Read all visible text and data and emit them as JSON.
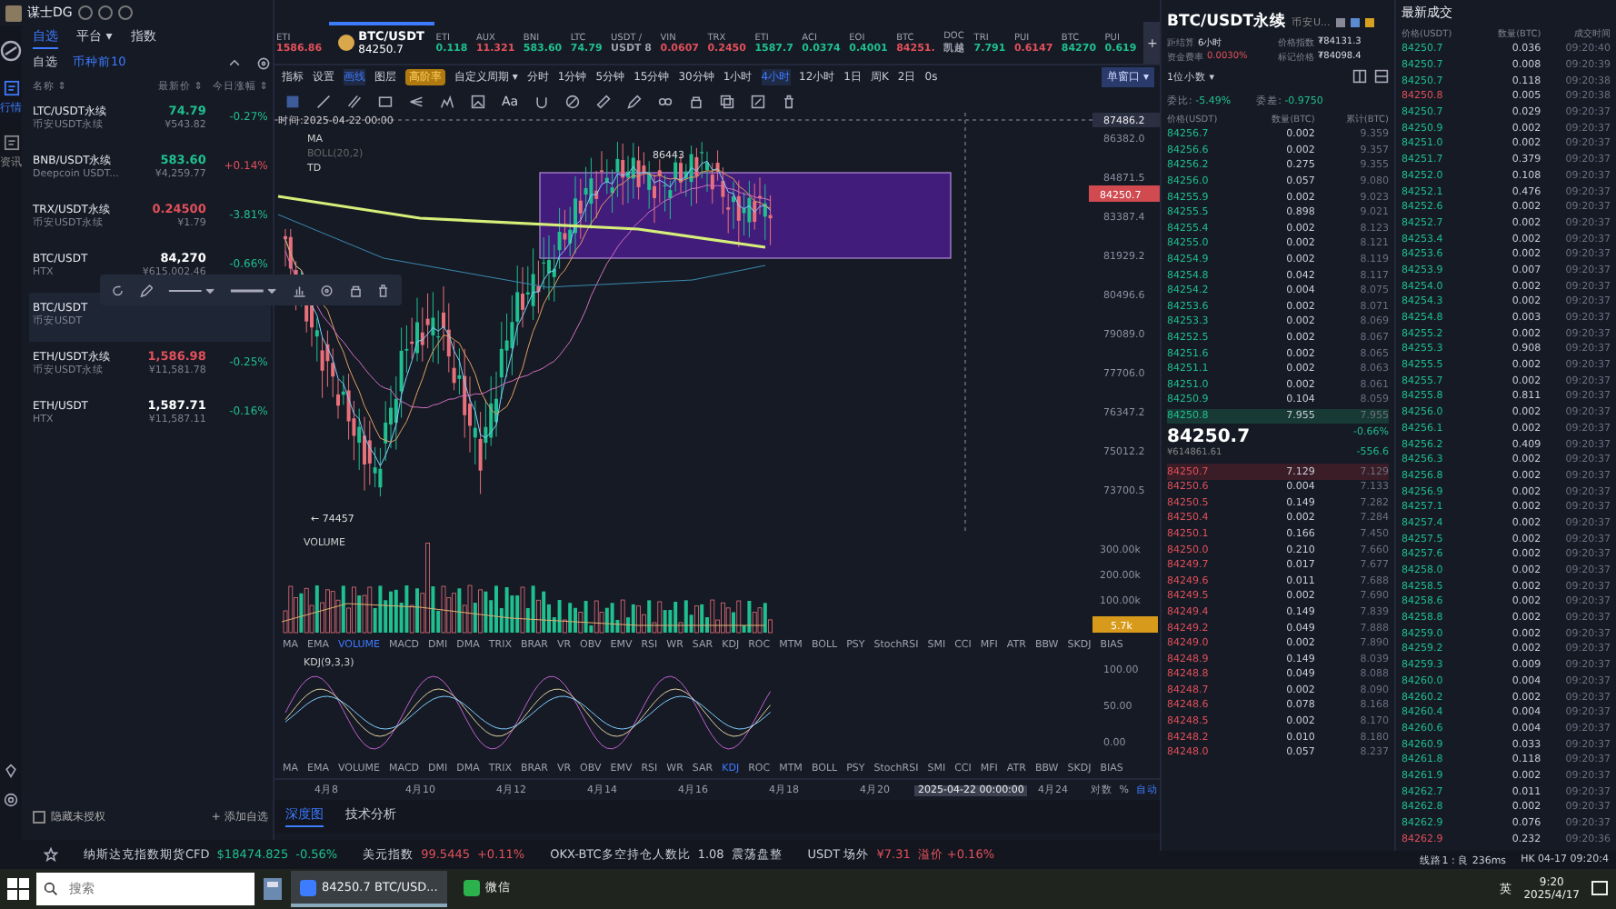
{
  "app_title": "谋士DG",
  "rail": [
    {
      "label": "行情",
      "selected": true
    },
    {
      "label": "资讯",
      "selected": false
    }
  ],
  "watch_tabs": [
    {
      "label": "自选",
      "selected": true
    },
    {
      "label": "平台 ▾",
      "selected": false
    },
    {
      "label": "指数",
      "selected": false
    }
  ],
  "sub_tabs": [
    {
      "label": "自选",
      "selected": false
    },
    {
      "label": "币种前10",
      "selected": true
    }
  ],
  "list_columns": [
    "名称 ⇕",
    "最新价 ⇕",
    "今日涨幅 ⇕"
  ],
  "watchlist": [
    {
      "name": "LTC/USDT永续",
      "exchange": "币安USDT永续",
      "price": {
        "text": "74.79",
        "color": "#1fbf8f"
      },
      "cny": "¥543.82",
      "change": {
        "text": "-0.27%",
        "color": "#1fbf8f"
      },
      "selected": false
    },
    {
      "name": "BNB/USDT永续",
      "exchange": "Deepcoin USDT...",
      "price": {
        "text": "583.60",
        "color": "#1fbf8f"
      },
      "cny": "¥4,259.77",
      "change": {
        "text": "+0.14%",
        "color": "#e0505a"
      },
      "selected": false
    },
    {
      "name": "TRX/USDT永续",
      "exchange": "币安USDT永续",
      "price": {
        "text": "0.24500",
        "color": "#e0505a"
      },
      "cny": "¥1.79",
      "change": {
        "text": "-3.81%",
        "color": "#1fbf8f"
      },
      "selected": false
    },
    {
      "name": "BTC/USDT",
      "exchange": "HTX",
      "price": {
        "text": "84,270",
        "color": "#ffffff"
      },
      "cny": "¥615,002.46",
      "change": {
        "text": "-0.66%",
        "color": "#1fbf8f"
      },
      "selected": false
    },
    {
      "name": "BTC/USDT",
      "exchange": "币安USDT",
      "selected": true
    },
    {
      "name": "ETH/USDT永续",
      "exchange": "币安USDT永续",
      "price": {
        "text": "1,586.98",
        "color": "#e0505a"
      },
      "cny": "¥11,581.78",
      "change": {
        "text": "-0.25%",
        "color": "#1fbf8f"
      },
      "selected": false
    },
    {
      "name": "ETH/USDT",
      "exchange": "HTX",
      "price": {
        "text": "1,587.71",
        "color": "#ffffff"
      },
      "cny": "¥11,587.11",
      "change": {
        "text": "-0.16%",
        "color": "#1fbf8f"
      },
      "selected": false
    }
  ],
  "hide_unauthorized": {
    "label": "隐藏未授权",
    "checked": false
  },
  "add_watch": "+ 添加自选",
  "ticker_strip": [
    {
      "symbol": "ETI",
      "price": "1586.86",
      "color": "#e0505a",
      "selected": false
    },
    {
      "symbol": "BTC/USDT",
      "price": "84250.7",
      "color": "#ffffff",
      "selected": true
    },
    {
      "symbol": "ETI",
      "price": "0.118",
      "color": "#1fbf8f",
      "selected": false
    },
    {
      "symbol": "AUX",
      "price": "11.321",
      "color": "#e0505a",
      "selected": false
    },
    {
      "symbol": "BNI",
      "price": "583.60",
      "color": "#1fbf8f",
      "selected": false
    },
    {
      "symbol": "LTC",
      "price": "74.79",
      "color": "#1fbf8f",
      "selected": false
    },
    {
      "symbol": "USDT /",
      "price": "USDT 8",
      "color": "#9aa0ad",
      "selected": false
    },
    {
      "symbol": "VIN",
      "price": "0.0607",
      "color": "#e0505a",
      "selected": false
    },
    {
      "symbol": "TRX",
      "price": "0.2450",
      "color": "#e0505a",
      "selected": false
    },
    {
      "symbol": "ETI",
      "price": "1587.7",
      "color": "#1fbf8f",
      "selected": false
    },
    {
      "symbol": "ACI",
      "price": "0.0374",
      "color": "#1fbf8f",
      "selected": false
    },
    {
      "symbol": "EOI",
      "price": "0.4001",
      "color": "#1fbf8f",
      "selected": false
    },
    {
      "symbol": "BTC",
      "price": "84251.",
      "color": "#e0505a",
      "selected": false
    },
    {
      "symbol": "DOC",
      "price": "凯越",
      "color": "#9aa0ad",
      "selected": false
    },
    {
      "symbol": "TRI",
      "price": "7.791",
      "color": "#1fbf8f",
      "selected": false
    },
    {
      "symbol": "PUI",
      "price": "0.6147",
      "color": "#e0505a",
      "selected": false
    },
    {
      "symbol": "BTC",
      "price": "84270",
      "color": "#1fbf8f",
      "selected": false
    },
    {
      "symbol": "PUI",
      "price": "0.619",
      "color": "#1fbf8f",
      "selected": false
    }
  ],
  "add_tab": "+",
  "toolbar": [
    {
      "label": "指标",
      "kind": "tool",
      "selected": false
    },
    {
      "label": "设置",
      "kind": "tool",
      "selected": false
    },
    {
      "label": "画线",
      "kind": "tool",
      "selected": true
    },
    {
      "label": "图层",
      "kind": "tool",
      "selected": false
    },
    {
      "label": "高阶率",
      "kind": "badge",
      "selected": false
    },
    {
      "label": "自定义周期 ▾",
      "kind": "period",
      "selected": false
    },
    {
      "label": "分时",
      "kind": "period",
      "selected": false
    },
    {
      "label": "1分钟",
      "kind": "period",
      "selected": false
    },
    {
      "label": "5分钟",
      "kind": "period",
      "selected": false
    },
    {
      "label": "15分钟",
      "kind": "period",
      "selected": false
    },
    {
      "label": "30分钟",
      "kind": "period",
      "selected": false
    },
    {
      "label": "1小时",
      "kind": "period",
      "selected": false
    },
    {
      "label": "4小时",
      "kind": "period",
      "selected": true
    },
    {
      "label": "12小时",
      "kind": "period",
      "selected": false
    },
    {
      "label": "1日",
      "kind": "period",
      "selected": false
    },
    {
      "label": "周K",
      "kind": "period",
      "selected": false
    },
    {
      "label": "2日",
      "kind": "period",
      "selected": false
    },
    {
      "label": "0s",
      "kind": "period",
      "selected": false
    }
  ],
  "window_mode": "单窗口 ▾",
  "text_tool": "Aa",
  "chart": {
    "time_label": "时间:2025-04-22 00:00",
    "legends": [
      "MA",
      "BOLL(20,2)",
      "TD"
    ],
    "high_mark": "86443",
    "low_mark": "← 74457",
    "price_ticks": [
      "86382.0",
      "84871.5",
      "83387.4",
      "81929.2",
      "80496.6",
      "79089.0",
      "77706.0",
      "76347.2",
      "75012.2",
      "73700.5"
    ],
    "cursor_price": "87486.2",
    "last_price": "84250.7",
    "volume_title": "VOLUME",
    "volume_ticks": [
      "300.00k",
      "200.00k",
      "100.00k"
    ],
    "volume_last": "5.7k",
    "kdj_title": "KDJ(9,3,3)",
    "kdj_ticks": [
      "100.00",
      "50.00",
      "0.00"
    ],
    "x_ticks": [
      "4月8",
      "4月10",
      "4月12",
      "4月14",
      "4月16",
      "4月18",
      "4月20"
    ],
    "x_cursor": "2025-04-22 00:00:00",
    "x_last": "4月24",
    "scale_options": [
      {
        "label": "对数",
        "selected": false
      },
      {
        "label": "%",
        "selected": false
      },
      {
        "label": "自动",
        "selected": true
      }
    ]
  },
  "indicator_rows": [
    {
      "items": [
        {
          "label": "MA",
          "selected": false
        },
        {
          "label": "EMA",
          "selected": false
        },
        {
          "label": "VOLUME",
          "selected": true
        },
        {
          "label": "MACD",
          "selected": false
        },
        {
          "label": "DMI",
          "selected": false
        },
        {
          "label": "DMA",
          "selected": false
        },
        {
          "label": "TRIX",
          "selected": false
        },
        {
          "label": "BRAR",
          "selected": false
        },
        {
          "label": "VR",
          "selected": false
        },
        {
          "label": "OBV",
          "selected": false
        },
        {
          "label": "EMV",
          "selected": false
        },
        {
          "label": "RSI",
          "selected": false
        },
        {
          "label": "WR",
          "selected": false
        },
        {
          "label": "SAR",
          "selected": false
        },
        {
          "label": "KDJ",
          "selected": false
        },
        {
          "label": "ROC",
          "selected": false
        },
        {
          "label": "MTM",
          "selected": false
        },
        {
          "label": "BOLL",
          "selected": false
        },
        {
          "label": "PSY",
          "selected": false
        },
        {
          "label": "StochRSI",
          "selected": false
        },
        {
          "label": "SMI",
          "selected": false
        },
        {
          "label": "CCI",
          "selected": false
        },
        {
          "label": "MFI",
          "selected": false
        },
        {
          "label": "ATR",
          "selected": false
        },
        {
          "label": "BBW",
          "selected": false
        },
        {
          "label": "SKDJ",
          "selected": false
        },
        {
          "label": "BIAS",
          "selected": false
        }
      ]
    },
    {
      "items": [
        {
          "label": "MA",
          "selected": false
        },
        {
          "label": "EMA",
          "selected": false
        },
        {
          "label": "VOLUME",
          "selected": false
        },
        {
          "label": "MACD",
          "selected": false
        },
        {
          "label": "DMI",
          "selected": false
        },
        {
          "label": "DMA",
          "selected": false
        },
        {
          "label": "TRIX",
          "selected": false
        },
        {
          "label": "BRAR",
          "selected": false
        },
        {
          "label": "VR",
          "selected": false
        },
        {
          "label": "OBV",
          "selected": false
        },
        {
          "label": "EMV",
          "selected": false
        },
        {
          "label": "RSI",
          "selected": false
        },
        {
          "label": "WR",
          "selected": false
        },
        {
          "label": "SAR",
          "selected": false
        },
        {
          "label": "KDJ",
          "selected": true
        },
        {
          "label": "ROC",
          "selected": false
        },
        {
          "label": "MTM",
          "selected": false
        },
        {
          "label": "BOLL",
          "selected": false
        },
        {
          "label": "PSY",
          "selected": false
        },
        {
          "label": "StochRSI",
          "selected": false
        },
        {
          "label": "SMI",
          "selected": false
        },
        {
          "label": "CCI",
          "selected": false
        },
        {
          "label": "MFI",
          "selected": false
        },
        {
          "label": "ATR",
          "selected": false
        },
        {
          "label": "BBW",
          "selected": false
        },
        {
          "label": "SKDJ",
          "selected": false
        },
        {
          "label": "BIAS",
          "selected": false
        }
      ]
    }
  ],
  "bottom_tabs": [
    {
      "label": "深度图",
      "selected": true
    },
    {
      "label": "技术分析",
      "selected": false
    }
  ],
  "info_bar": [
    {
      "name": "纳斯达克指数期货CFD",
      "value": "$18474.825",
      "change": "-0.56%",
      "color": "#1fbf8f"
    },
    {
      "name": "美元指数",
      "value": "99.5445",
      "change": "+0.11%",
      "color": "#e0505a"
    },
    {
      "name": "OKX-BTC多空持仓人数比",
      "value": "1.08",
      "change": "震荡盘整",
      "color": "#c9cdd6"
    },
    {
      "name": "USDT 场外",
      "value": "¥7.31",
      "change": "溢价 +0.16%",
      "color": "#e0505a"
    }
  ],
  "contract": {
    "title": "BTC/USDT永续",
    "exchange": "币安U...",
    "stats": [
      {
        "label": "距结算",
        "value": "6小时",
        "kind": "plain"
      },
      {
        "label": "价格指数",
        "value": "₮84131.3",
        "kind": "plain"
      },
      {
        "label": "资金费率",
        "value": "0.0030%",
        "kind": "rate"
      },
      {
        "label": "标记价格",
        "value": "₮84098.4",
        "kind": "plain"
      }
    ],
    "precision": "1位小数 ▾",
    "ratio_label": "委比:",
    "ratio": "-5.49%",
    "diff_label": "委差:",
    "diff": "-0.9750"
  },
  "book_columns": [
    "价格(USDT)",
    "数量(BTC)",
    "累计(BTC)"
  ],
  "asks": [
    {
      "price": "84256.7",
      "qty": "0.002",
      "total": "9.359",
      "highlighted": false
    },
    {
      "price": "84256.6",
      "qty": "0.002",
      "total": "9.357",
      "highlighted": false
    },
    {
      "price": "84256.2",
      "qty": "0.275",
      "total": "9.355",
      "highlighted": false
    },
    {
      "price": "84256.0",
      "qty": "0.057",
      "total": "9.080",
      "highlighted": false
    },
    {
      "price": "84255.9",
      "qty": "0.002",
      "total": "9.023",
      "highlighted": false
    },
    {
      "price": "84255.5",
      "qty": "0.898",
      "total": "9.021",
      "highlighted": false
    },
    {
      "price": "84255.4",
      "qty": "0.002",
      "total": "8.123",
      "highlighted": false
    },
    {
      "price": "84255.0",
      "qty": "0.002",
      "total": "8.121",
      "highlighted": false
    },
    {
      "price": "84254.9",
      "qty": "0.002",
      "total": "8.119",
      "highlighted": false
    },
    {
      "price": "84254.8",
      "qty": "0.042",
      "total": "8.117",
      "highlighted": false
    },
    {
      "price": "84254.2",
      "qty": "0.004",
      "total": "8.075",
      "highlighted": false
    },
    {
      "price": "84253.6",
      "qty": "0.002",
      "total": "8.071",
      "highlighted": false
    },
    {
      "price": "84253.3",
      "qty": "0.002",
      "total": "8.069",
      "highlighted": false
    },
    {
      "price": "84252.5",
      "qty": "0.002",
      "total": "8.067",
      "highlighted": false
    },
    {
      "price": "84251.6",
      "qty": "0.002",
      "total": "8.065",
      "highlighted": false
    },
    {
      "price": "84251.1",
      "qty": "0.002",
      "total": "8.063",
      "highlighted": false
    },
    {
      "price": "84251.0",
      "qty": "0.002",
      "total": "8.061",
      "highlighted": false
    },
    {
      "price": "84250.9",
      "qty": "0.104",
      "total": "8.059",
      "highlighted": false
    },
    {
      "price": "84250.8",
      "qty": "7.955",
      "total": "7.955",
      "highlighted": true
    }
  ],
  "mid": {
    "price": "84250.7",
    "cny": "¥614861.61",
    "change": "-0.66%",
    "delta": "-556.6"
  },
  "bids": [
    {
      "price": "84250.7",
      "qty": "7.129",
      "total": "7.129",
      "highlighted": true
    },
    {
      "price": "84250.6",
      "qty": "0.004",
      "total": "7.133",
      "highlighted": false
    },
    {
      "price": "84250.5",
      "qty": "0.149",
      "total": "7.282",
      "highlighted": false
    },
    {
      "price": "84250.4",
      "qty": "0.002",
      "total": "7.284",
      "highlighted": false
    },
    {
      "price": "84250.1",
      "qty": "0.166",
      "total": "7.450",
      "highlighted": false
    },
    {
      "price": "84250.0",
      "qty": "0.210",
      "total": "7.660",
      "highlighted": false
    },
    {
      "price": "84249.7",
      "qty": "0.017",
      "total": "7.677",
      "highlighted": false
    },
    {
      "price": "84249.6",
      "qty": "0.011",
      "total": "7.688",
      "highlighted": false
    },
    {
      "price": "84249.5",
      "qty": "0.002",
      "total": "7.690",
      "highlighted": false
    },
    {
      "price": "84249.4",
      "qty": "0.149",
      "total": "7.839",
      "highlighted": false
    },
    {
      "price": "84249.2",
      "qty": "0.049",
      "total": "7.888",
      "highlighted": false
    },
    {
      "price": "84249.0",
      "qty": "0.002",
      "total": "7.890",
      "highlighted": false
    },
    {
      "price": "84248.9",
      "qty": "0.149",
      "total": "8.039",
      "highlighted": false
    },
    {
      "price": "84248.8",
      "qty": "0.049",
      "total": "8.088",
      "highlighted": false
    },
    {
      "price": "84248.7",
      "qty": "0.002",
      "total": "8.090",
      "highlighted": false
    },
    {
      "price": "84248.6",
      "qty": "0.078",
      "total": "8.168",
      "highlighted": false
    },
    {
      "price": "84248.5",
      "qty": "0.002",
      "total": "8.170",
      "highlighted": false
    },
    {
      "price": "84248.2",
      "qty": "0.010",
      "total": "8.180",
      "highlighted": false
    },
    {
      "price": "84248.0",
      "qty": "0.057",
      "total": "8.237",
      "highlighted": false
    }
  ],
  "trades_title": "最新成交",
  "trade_columns": [
    "价格(USDT)",
    "数量(BTC)",
    "成交时间"
  ],
  "trades": [
    {
      "price": "84250.7",
      "qty": "0.036",
      "time": "09:20:40",
      "color": "#1fbf8f"
    },
    {
      "price": "84250.7",
      "qty": "0.008",
      "time": "09:20:39",
      "color": "#1fbf8f"
    },
    {
      "price": "84250.7",
      "qty": "0.118",
      "time": "09:20:38",
      "color": "#1fbf8f"
    },
    {
      "price": "84250.8",
      "qty": "0.005",
      "time": "09:20:38",
      "color": "#e0505a"
    },
    {
      "price": "84250.7",
      "qty": "0.029",
      "time": "09:20:37",
      "color": "#1fbf8f"
    },
    {
      "price": "84250.9",
      "qty": "0.002",
      "time": "09:20:37",
      "color": "#1fbf8f"
    },
    {
      "price": "84251.0",
      "qty": "0.002",
      "time": "09:20:37",
      "color": "#1fbf8f"
    },
    {
      "price": "84251.7",
      "qty": "0.379",
      "time": "09:20:37",
      "color": "#1fbf8f"
    },
    {
      "price": "84252.0",
      "qty": "0.108",
      "time": "09:20:37",
      "color": "#1fbf8f"
    },
    {
      "price": "84252.1",
      "qty": "0.476",
      "time": "09:20:37",
      "color": "#1fbf8f"
    },
    {
      "price": "84252.6",
      "qty": "0.002",
      "time": "09:20:37",
      "color": "#1fbf8f"
    },
    {
      "price": "84252.7",
      "qty": "0.002",
      "time": "09:20:37",
      "color": "#1fbf8f"
    },
    {
      "price": "84253.4",
      "qty": "0.002",
      "time": "09:20:37",
      "color": "#1fbf8f"
    },
    {
      "price": "84253.6",
      "qty": "0.002",
      "time": "09:20:37",
      "color": "#1fbf8f"
    },
    {
      "price": "84253.9",
      "qty": "0.007",
      "time": "09:20:37",
      "color": "#1fbf8f"
    },
    {
      "price": "84254.0",
      "qty": "0.002",
      "time": "09:20:37",
      "color": "#1fbf8f"
    },
    {
      "price": "84254.3",
      "qty": "0.002",
      "time": "09:20:37",
      "color": "#1fbf8f"
    },
    {
      "price": "84254.8",
      "qty": "0.003",
      "time": "09:20:37",
      "color": "#1fbf8f"
    },
    {
      "price": "84255.2",
      "qty": "0.002",
      "time": "09:20:37",
      "color": "#1fbf8f"
    },
    {
      "price": "84255.3",
      "qty": "0.908",
      "time": "09:20:37",
      "color": "#1fbf8f"
    },
    {
      "price": "84255.5",
      "qty": "0.002",
      "time": "09:20:37",
      "color": "#1fbf8f"
    },
    {
      "price": "84255.7",
      "qty": "0.002",
      "time": "09:20:37",
      "color": "#1fbf8f"
    },
    {
      "price": "84255.8",
      "qty": "0.811",
      "time": "09:20:37",
      "color": "#1fbf8f"
    },
    {
      "price": "84256.0",
      "qty": "0.002",
      "time": "09:20:37",
      "color": "#1fbf8f"
    },
    {
      "price": "84256.1",
      "qty": "0.002",
      "time": "09:20:37",
      "color": "#1fbf8f"
    },
    {
      "price": "84256.2",
      "qty": "0.409",
      "time": "09:20:37",
      "color": "#1fbf8f"
    },
    {
      "price": "84256.3",
      "qty": "0.002",
      "time": "09:20:37",
      "color": "#1fbf8f"
    },
    {
      "price": "84256.8",
      "qty": "0.002",
      "time": "09:20:37",
      "color": "#1fbf8f"
    },
    {
      "price": "84256.9",
      "qty": "0.002",
      "time": "09:20:37",
      "color": "#1fbf8f"
    },
    {
      "price": "84257.1",
      "qty": "0.002",
      "time": "09:20:37",
      "color": "#1fbf8f"
    },
    {
      "price": "84257.4",
      "qty": "0.002",
      "time": "09:20:37",
      "color": "#1fbf8f"
    },
    {
      "price": "84257.5",
      "qty": "0.002",
      "time": "09:20:37",
      "color": "#1fbf8f"
    },
    {
      "price": "84257.6",
      "qty": "0.002",
      "time": "09:20:37",
      "color": "#1fbf8f"
    },
    {
      "price": "84258.0",
      "qty": "0.002",
      "time": "09:20:37",
      "color": "#1fbf8f"
    },
    {
      "price": "84258.5",
      "qty": "0.002",
      "time": "09:20:37",
      "color": "#1fbf8f"
    },
    {
      "price": "84258.6",
      "qty": "0.002",
      "time": "09:20:37",
      "color": "#1fbf8f"
    },
    {
      "price": "84258.8",
      "qty": "0.002",
      "time": "09:20:37",
      "color": "#1fbf8f"
    },
    {
      "price": "84259.0",
      "qty": "0.002",
      "time": "09:20:37",
      "color": "#1fbf8f"
    },
    {
      "price": "84259.2",
      "qty": "0.002",
      "time": "09:20:37",
      "color": "#1fbf8f"
    },
    {
      "price": "84259.3",
      "qty": "0.009",
      "time": "09:20:37",
      "color": "#1fbf8f"
    },
    {
      "price": "84260.0",
      "qty": "0.004",
      "time": "09:20:37",
      "color": "#1fbf8f"
    },
    {
      "price": "84260.2",
      "qty": "0.002",
      "time": "09:20:37",
      "color": "#1fbf8f"
    },
    {
      "price": "84260.4",
      "qty": "0.004",
      "time": "09:20:37",
      "color": "#1fbf8f"
    },
    {
      "price": "84260.6",
      "qty": "0.004",
      "time": "09:20:37",
      "color": "#1fbf8f"
    },
    {
      "price": "84260.9",
      "qty": "0.033",
      "time": "09:20:37",
      "color": "#1fbf8f"
    },
    {
      "price": "84261.8",
      "qty": "0.118",
      "time": "09:20:37",
      "color": "#1fbf8f"
    },
    {
      "price": "84261.9",
      "qty": "0.002",
      "time": "09:20:37",
      "color": "#1fbf8f"
    },
    {
      "price": "84262.7",
      "qty": "0.011",
      "time": "09:20:37",
      "color": "#1fbf8f"
    },
    {
      "price": "84262.8",
      "qty": "0.002",
      "time": "09:20:37",
      "color": "#1fbf8f"
    },
    {
      "price": "84262.9",
      "qty": "0.076",
      "time": "09:20:37",
      "color": "#1fbf8f"
    },
    {
      "price": "84262.9",
      "qty": "0.232",
      "time": "09:20:36",
      "color": "#e0505a"
    }
  ],
  "status": {
    "line": "线路1 : 良 236ms",
    "clock": "HK 04-17 09:20:4"
  },
  "taskbar": {
    "search_placeholder": "搜索",
    "apps": [
      {
        "label": "84250.7 BTC/USD...",
        "selected": true
      },
      {
        "label": "微信",
        "selected": false
      }
    ],
    "ime": "英",
    "time": "9:20",
    "date": "2025/4/17"
  }
}
